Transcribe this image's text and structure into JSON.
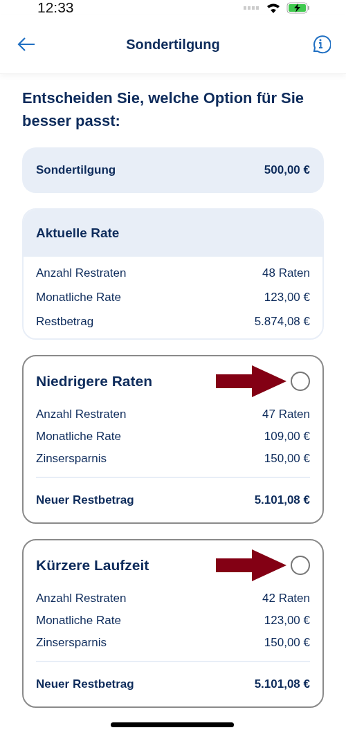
{
  "status_bar": {
    "time": "12:33"
  },
  "header": {
    "title": "Sondertilgung"
  },
  "heading": "Entscheiden Sie, welche Option für Sie besser passt:",
  "summary": {
    "label": "Sondertilgung",
    "value": "500,00 €"
  },
  "current": {
    "title": "Aktuelle Rate",
    "rows": [
      {
        "label": "Anzahl Restraten",
        "value": "48 Raten"
      },
      {
        "label": "Monatliche Rate",
        "value": "123,00 €"
      },
      {
        "label": "Restbetrag",
        "value": "5.874,08 €"
      }
    ]
  },
  "options": [
    {
      "title": "Niedrigere Raten",
      "selected": false,
      "marked": true,
      "rows": [
        {
          "label": "Anzahl Restraten",
          "value": "47 Raten"
        },
        {
          "label": "Monatliche Rate",
          "value": "109,00 €"
        },
        {
          "label": "Zinsersparnis",
          "value": "150,00 €"
        }
      ],
      "total": {
        "label": "Neuer Restbetrag",
        "value": "5.101,08 €"
      }
    },
    {
      "title": "Kürzere Laufzeit",
      "selected": false,
      "marked": true,
      "rows": [
        {
          "label": "Anzahl Restraten",
          "value": "42 Raten"
        },
        {
          "label": "Monatliche Rate",
          "value": "123,00 €"
        },
        {
          "label": "Zinsersparnis",
          "value": "150,00 €"
        }
      ],
      "total": {
        "label": "Neuer Restbetrag",
        "value": "5.101,08 €"
      }
    }
  ]
}
